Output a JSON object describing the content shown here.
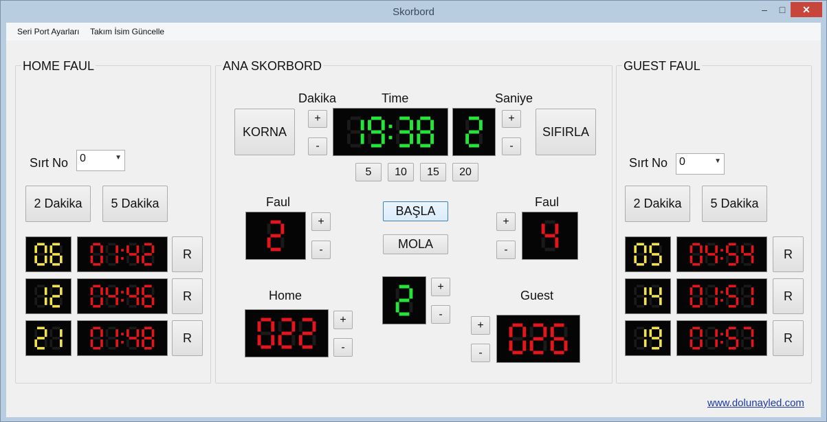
{
  "window": {
    "title": "Skorbord",
    "min_glyph": "–",
    "max_glyph": "□",
    "close_glyph": "✕"
  },
  "menu": [
    "Seri Port Ayarları",
    "Takım İsim Güncelle"
  ],
  "home_panel": {
    "title": "HOME FAUL",
    "sirt_label": "Sırt No",
    "sirt_value": "0",
    "btn_2": "2 Dakika",
    "btn_5": "5 Dakika",
    "reset_label": "R",
    "rows": [
      {
        "no": "06",
        "time": "01:42"
      },
      {
        "no": "12",
        "time": "04:46"
      },
      {
        "no": "21",
        "time": "01:48"
      }
    ]
  },
  "main_panel": {
    "title": "ANA SKORBORD",
    "dakika_label": "Dakika",
    "time_label": "Time",
    "saniye_label": "Saniye",
    "korna": "KORNA",
    "sifirla": "SIFIRLA",
    "clock": "19:38",
    "saniye_value": "2",
    "presets": [
      "5",
      "10",
      "15",
      "20"
    ],
    "faul_label": "Faul",
    "home_faul": "2",
    "guest_faul": "4",
    "basla": "BAŞLA",
    "mola": "MOLA",
    "home_label": "Home",
    "guest_label": "Guest",
    "home_score": "022",
    "guest_score": "026",
    "period": "2",
    "plus": "+",
    "minus": "-"
  },
  "guest_panel": {
    "title": "GUEST FAUL",
    "sirt_label": "Sırt No",
    "sirt_value": "0",
    "btn_2": "2 Dakika",
    "btn_5": "5 Dakika",
    "reset_label": "R",
    "rows": [
      {
        "no": "05",
        "time": "04:54"
      },
      {
        "no": "14",
        "time": "01:51"
      },
      {
        "no": "19",
        "time": "01:57"
      }
    ]
  },
  "footer_link": "www.dolunayled.com",
  "colors": {
    "green": "#27e43a",
    "red": "#e3161b",
    "yellow": "#f2e34a",
    "off": "#1a1a1a"
  }
}
